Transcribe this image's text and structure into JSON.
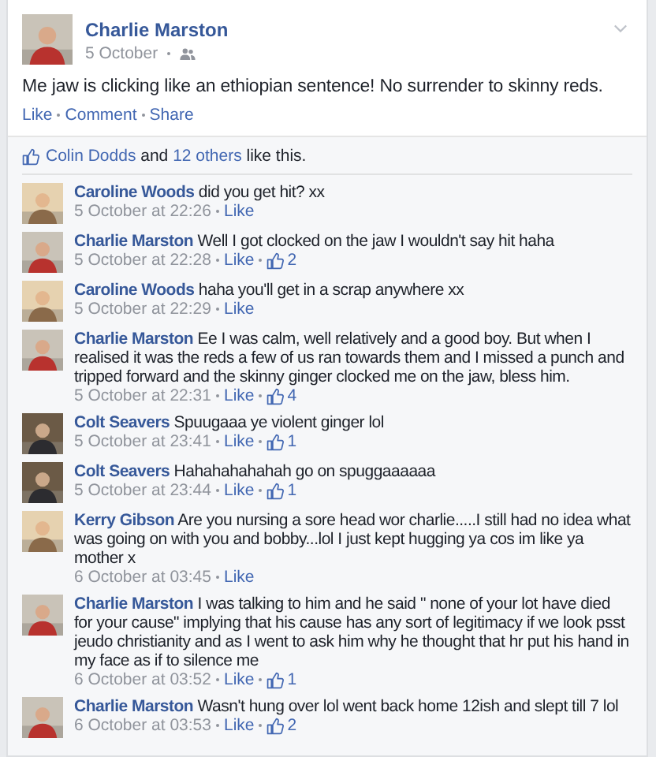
{
  "post": {
    "author": "Charlie Marston",
    "date": "5 October",
    "text": "Me jaw is clicking like an ethiopian sentence! No surrender to skinny reds.",
    "actions": [
      "Like",
      "Comment",
      "Share"
    ]
  },
  "likes_summary": {
    "name": "Colin Dodds",
    "joiner": "and",
    "others": "12 others",
    "tail": "like this."
  },
  "comments": [
    {
      "author": "Caroline Woods",
      "text": "did you get hit? xx",
      "time": "5 October at 22:26",
      "like": "Like"
    },
    {
      "author": "Charlie Marston",
      "text": "Well I got clocked on the jaw I wouldn't say hit haha",
      "time": "5 October at 22:28",
      "like": "Like",
      "likes": "2"
    },
    {
      "author": "Caroline Woods",
      "text": "haha you'll get in a scrap anywhere xx",
      "time": "5 October at 22:29",
      "like": "Like"
    },
    {
      "author": "Charlie Marston",
      "text": "Ee I was calm, well relatively and a good boy. But when I realised it was the reds a few of us ran towards them and I missed a punch and tripped forward and the skinny ginger clocked me on the jaw, bless him.",
      "time": "5 October at 22:31",
      "like": "Like",
      "likes": "4"
    },
    {
      "author": "Colt Seavers",
      "text": "Spuugaaa ye violent ginger lol",
      "time": "5 October at 23:41",
      "like": "Like",
      "likes": "1"
    },
    {
      "author": "Colt Seavers",
      "text": "Hahahahahahah go on spuggaaaaaa",
      "time": "5 October at 23:44",
      "like": "Like",
      "likes": "1"
    },
    {
      "author": "Kerry Gibson",
      "text": "Are you nursing a sore head wor charlie.....I still had no idea what was going on with you and bobby...lol I just kept hugging ya cos im like ya mother x",
      "time": "6 October at 03:45",
      "like": "Like"
    },
    {
      "author": "Charlie Marston",
      "text": "I was talking to him and he said \" none of your lot have died for your cause\" implying that his cause has any sort of legitimacy if we look psst jeudo christianity and as I went to ask him why he thought that hr put his hand in my face as if to silence me",
      "time": "6 October at 03:52",
      "like": "Like",
      "likes": "1"
    },
    {
      "author": "Charlie Marston",
      "text": "Wasn't hung over lol went back home 12ish and slept till 7 lol",
      "time": "6 October at 03:53",
      "like": "Like",
      "likes": "2"
    }
  ]
}
